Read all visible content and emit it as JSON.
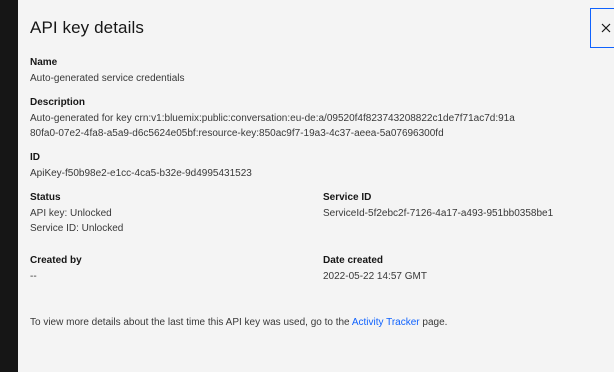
{
  "modal": {
    "title": "API key details",
    "close_icon": "close-icon"
  },
  "fields": {
    "name": {
      "label": "Name",
      "value": "Auto-generated service credentials"
    },
    "description": {
      "label": "Description",
      "line1": "Auto-generated for key crn:v1:bluemix:public:conversation:eu-de:a/09520f4f823743208822c1de7f71ac7d:91a",
      "line2": "80fa0-07e2-4fa8-a5a9-d6c5624e05bf:resource-key:850ac9f7-19a3-4c37-aeea-5a07696300fd"
    },
    "id": {
      "label": "ID",
      "value": "ApiKey-f50b98e2-e1cc-4ca5-b32e-9d4995431523"
    },
    "status": {
      "label": "Status",
      "line1": "API key: Unlocked",
      "line2": "Service ID: Unlocked"
    },
    "service_id": {
      "label": "Service ID",
      "value": "ServiceId-5f2ebc2f-7126-4a17-a493-951bb0358be1"
    },
    "created_by": {
      "label": "Created by",
      "value": "--"
    },
    "date_created": {
      "label": "Date created",
      "value": "2022-05-22 14:57 GMT"
    }
  },
  "footnote": {
    "before": "To view more details about the last time this API key was used, go to the ",
    "link": "Activity Tracker",
    "after": " page."
  },
  "colors": {
    "link": "#0f62fe",
    "modal_bg": "#f4f4f4",
    "backdrop": "#161616"
  }
}
